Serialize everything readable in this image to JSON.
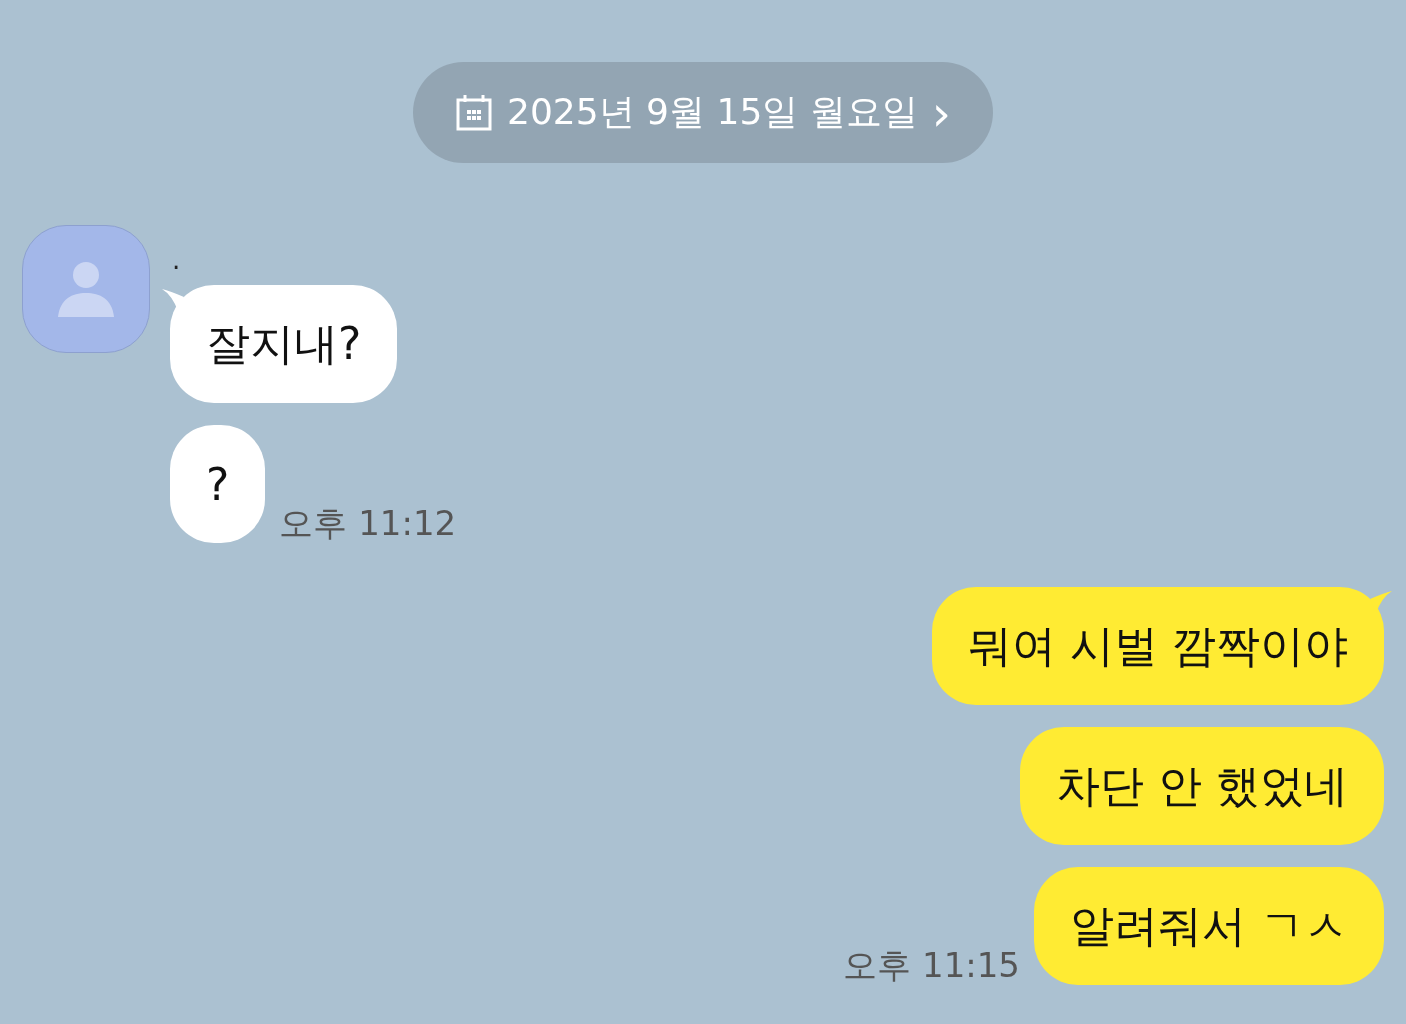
{
  "date_divider": {
    "text": "2025년 9월 15일 월요일",
    "arrow": "›"
  },
  "message_groups": [
    {
      "kind": "received",
      "sender": ".",
      "time": "오후 11:12",
      "bubbles": [
        {
          "text": "잘지내?"
        },
        {
          "text": "?"
        }
      ]
    },
    {
      "kind": "sent",
      "time": "오후 11:15",
      "bubbles": [
        {
          "text": "뭐여 시벌 깜짝이야"
        },
        {
          "text": "차단 안 했었네"
        },
        {
          "text": "알려줘서 ㄱㅅ"
        }
      ]
    }
  ]
}
